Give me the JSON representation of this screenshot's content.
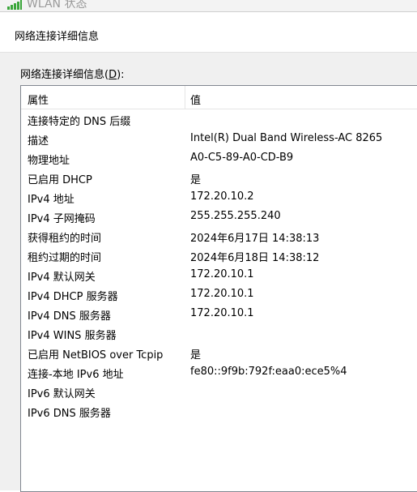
{
  "background_window": {
    "title": "WLAN 状态"
  },
  "dialog": {
    "title": "网络连接详细信息",
    "list_caption_prefix": "网络连接详细信息(",
    "list_caption_key": "D",
    "list_caption_suffix": "):"
  },
  "columns": {
    "property": "属性",
    "value": "值"
  },
  "rows": [
    {
      "k": "连接特定的 DNS 后缀",
      "v": ""
    },
    {
      "k": "描述",
      "v": "Intel(R) Dual Band Wireless-AC 8265"
    },
    {
      "k": "物理地址",
      "v": "A0-C5-89-A0-CD-B9"
    },
    {
      "k": "已启用 DHCP",
      "v": "是"
    },
    {
      "k": "IPv4 地址",
      "v": "172.20.10.2"
    },
    {
      "k": "IPv4 子网掩码",
      "v": "255.255.255.240"
    },
    {
      "k": "获得租约的时间",
      "v": "2024年6月17日 14:38:13"
    },
    {
      "k": "租约过期的时间",
      "v": "2024年6月18日 14:38:12"
    },
    {
      "k": "IPv4 默认网关",
      "v": "172.20.10.1"
    },
    {
      "k": "IPv4 DHCP 服务器",
      "v": "172.20.10.1"
    },
    {
      "k": "IPv4 DNS 服务器",
      "v": "172.20.10.1"
    },
    {
      "k": "IPv4 WINS 服务器",
      "v": ""
    },
    {
      "k": "已启用 NetBIOS over Tcpip",
      "v": "是"
    },
    {
      "k": "连接-本地 IPv6 地址",
      "v": "fe80::9f9b:792f:eaa0:ece5%4"
    },
    {
      "k": "IPv6 默认网关",
      "v": ""
    },
    {
      "k": "IPv6 DNS 服务器",
      "v": ""
    }
  ],
  "icons": {
    "background_window_icon": "wifi-signal-icon"
  },
  "colors": {
    "signal_green": "#3aa63a",
    "list_border": "#828790"
  }
}
